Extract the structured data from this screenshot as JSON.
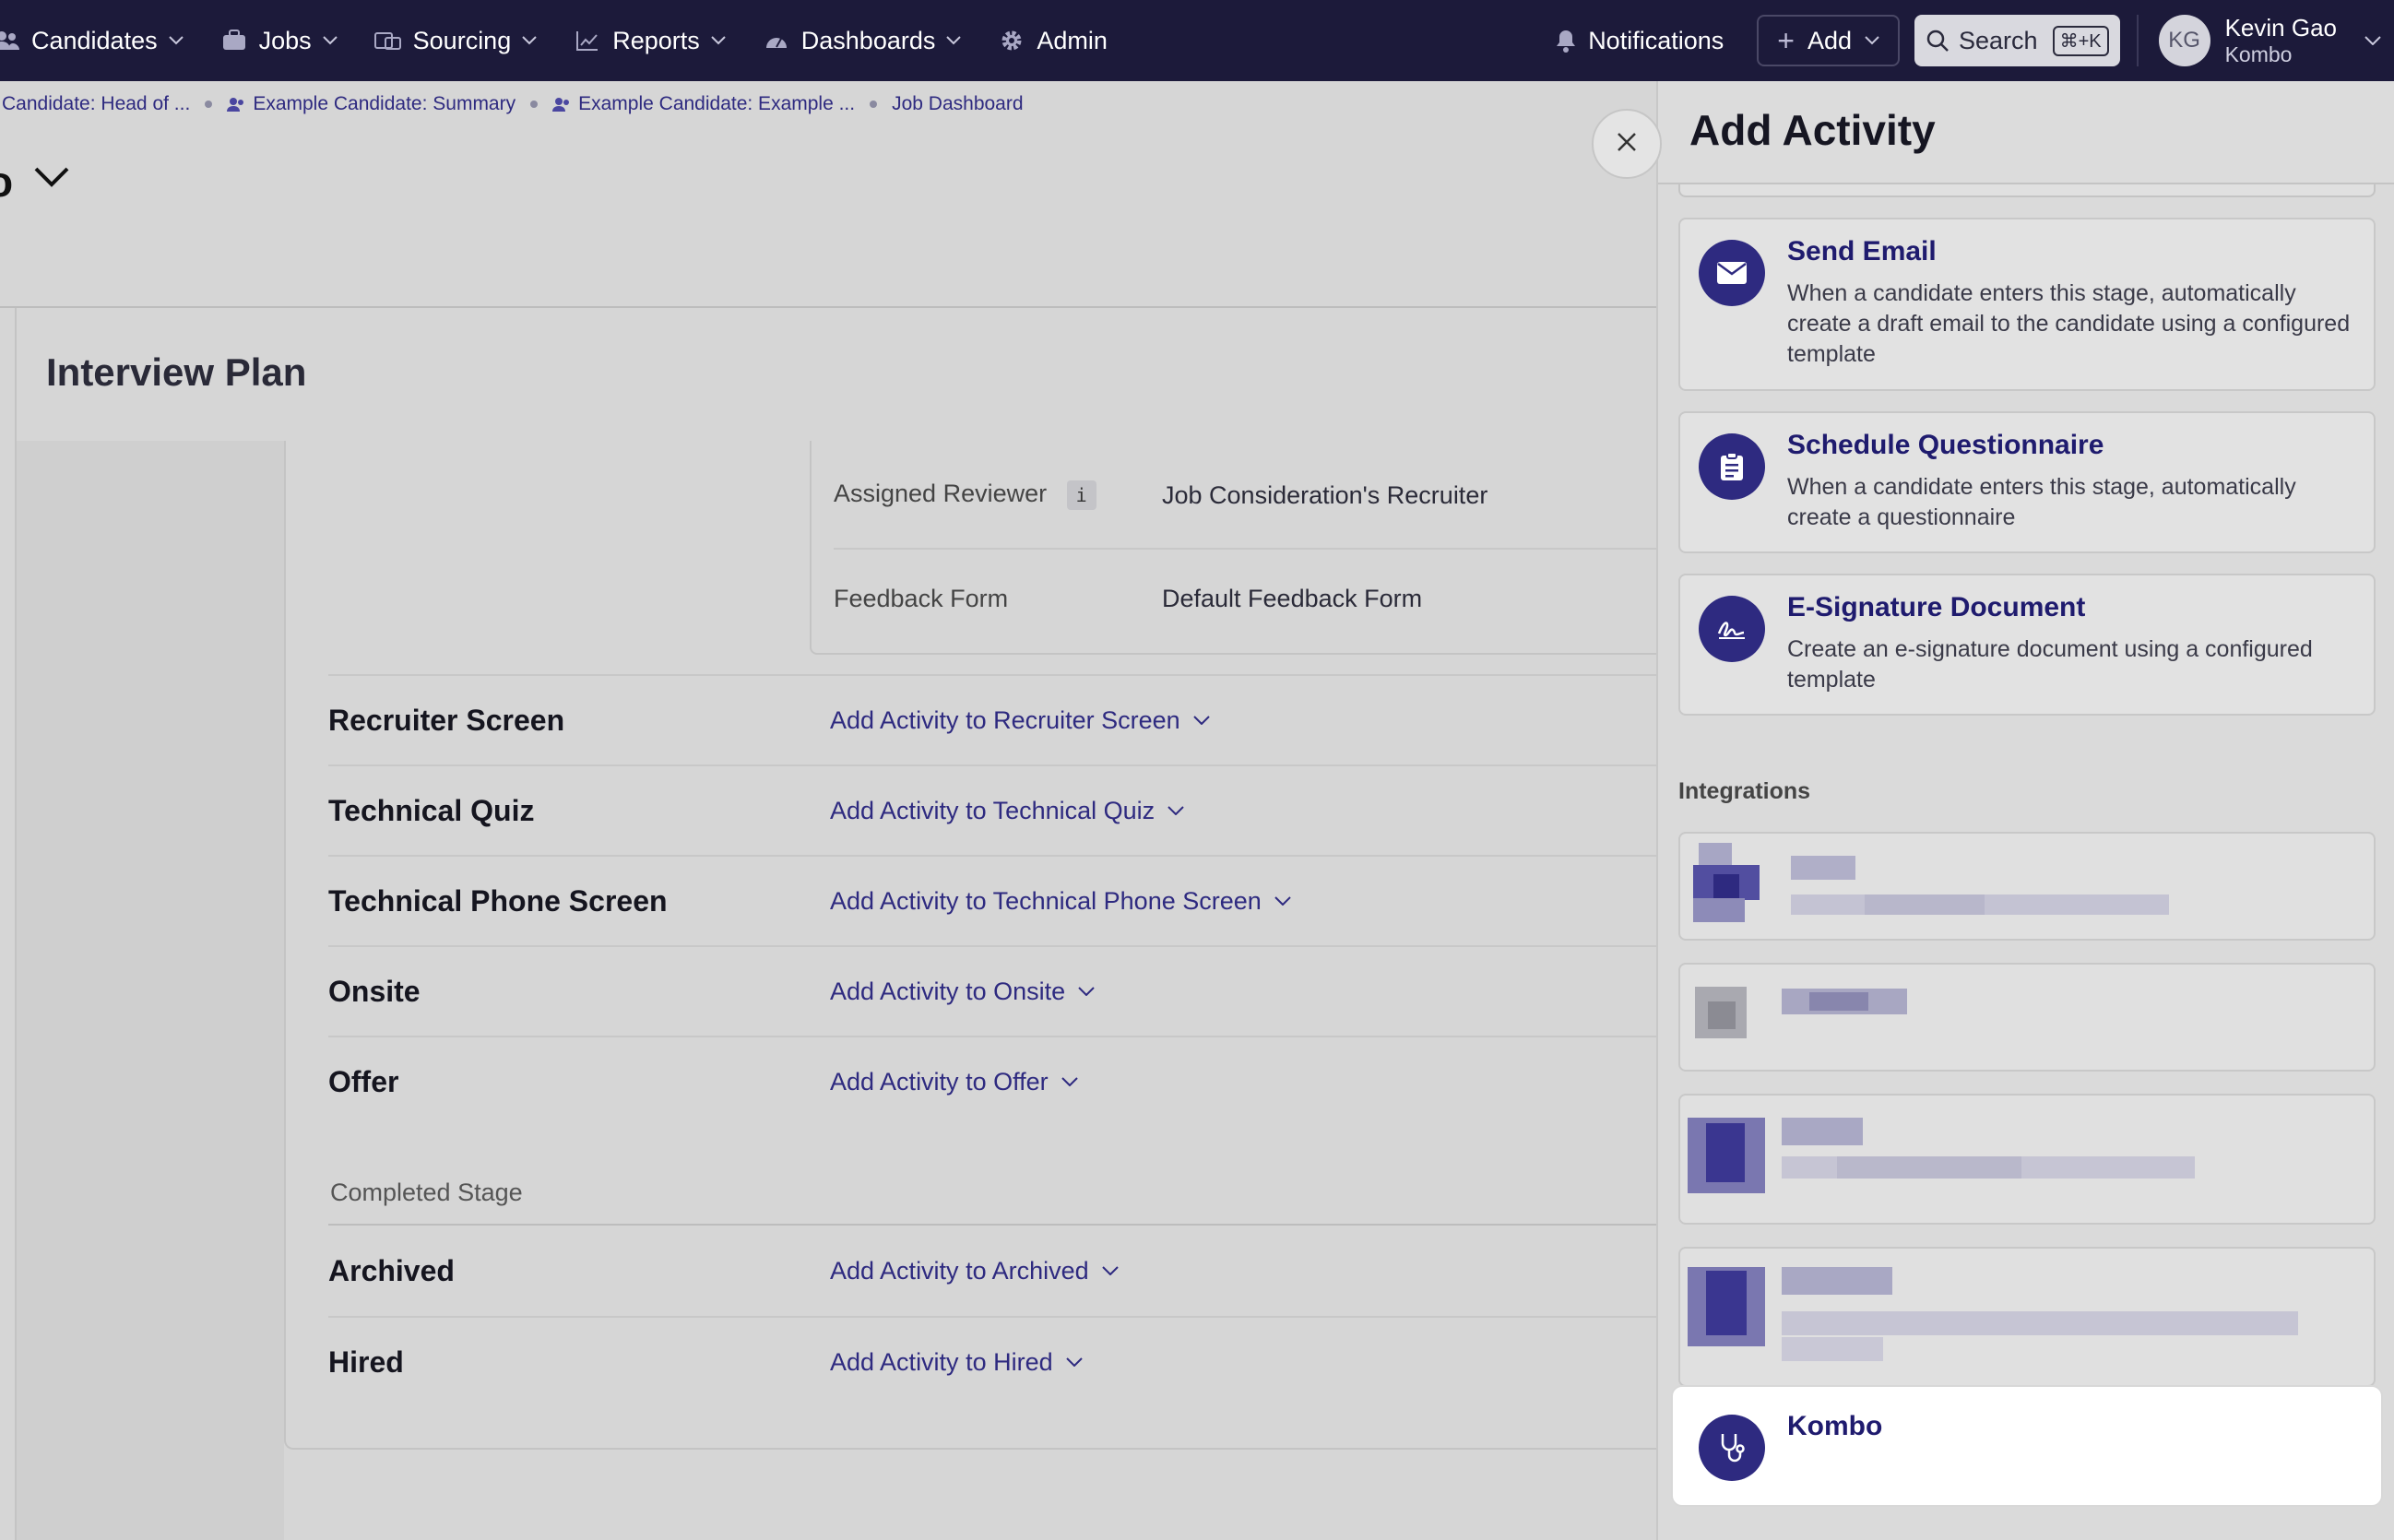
{
  "nav": {
    "items": [
      {
        "label": "Candidates",
        "icon": "people-icon"
      },
      {
        "label": "Jobs",
        "icon": "briefcase-icon"
      },
      {
        "label": "Sourcing",
        "icon": "sourcing-icon"
      },
      {
        "label": "Reports",
        "icon": "chart-line-icon"
      },
      {
        "label": "Dashboards",
        "icon": "gauge-icon"
      },
      {
        "label": "Admin",
        "icon": "gear-icon"
      }
    ],
    "notifications_label": "Notifications",
    "add_label": "Add",
    "search_label": "Search",
    "search_shortcut": "⌘+K",
    "user": {
      "initials": "KG",
      "name": "Kevin Gao",
      "org": "Kombo"
    }
  },
  "breadcrumbs": [
    {
      "label": "Candidate: Head of ..."
    },
    {
      "label": "Example Candidate: Summary"
    },
    {
      "label": "Example Candidate: Example ..."
    },
    {
      "label": "Job Dashboard"
    }
  ],
  "page": {
    "title_fragment": "o",
    "section_title": "Interview Plan"
  },
  "details": {
    "assigned_reviewer_label": "Assigned Reviewer",
    "info_badge": "i",
    "assigned_reviewer_value": "Job Consideration's Recruiter",
    "feedback_form_label": "Feedback Form",
    "feedback_form_value": "Default Feedback Form"
  },
  "stages": [
    {
      "name": "Recruiter Screen",
      "link": "Add Activity to Recruiter Screen"
    },
    {
      "name": "Technical Quiz",
      "link": "Add Activity to Technical Quiz"
    },
    {
      "name": "Technical Phone Screen",
      "link": "Add Activity to Technical Phone Screen"
    },
    {
      "name": "Onsite",
      "link": "Add Activity to Onsite"
    },
    {
      "name": "Offer",
      "link": "Add Activity to Offer"
    }
  ],
  "completed_stage_label": "Completed Stage",
  "completed_stages": [
    {
      "name": "Archived",
      "link": "Add Activity to Archived"
    },
    {
      "name": "Hired",
      "link": "Add Activity to Hired"
    }
  ],
  "drawer": {
    "title": "Add Activity",
    "activities": [
      {
        "title": "Send Email",
        "description": "When a candidate enters this stage, automatically create a draft email to the candidate using a configured template",
        "icon": "envelope-icon"
      },
      {
        "title": "Schedule Questionnaire",
        "description": "When a candidate enters this stage, automatically create a questionnaire",
        "icon": "clipboard-icon"
      },
      {
        "title": "E-Signature Document",
        "description": "Create an e-signature document using a configured template",
        "icon": "signature-icon"
      }
    ],
    "integrations_label": "Integrations",
    "kombo": {
      "title": "Kombo",
      "icon": "stethoscope-icon"
    }
  },
  "colors": {
    "nav_bg": "#1c1a3a",
    "accent": "#2e2a80",
    "link": "#2e2a80"
  }
}
